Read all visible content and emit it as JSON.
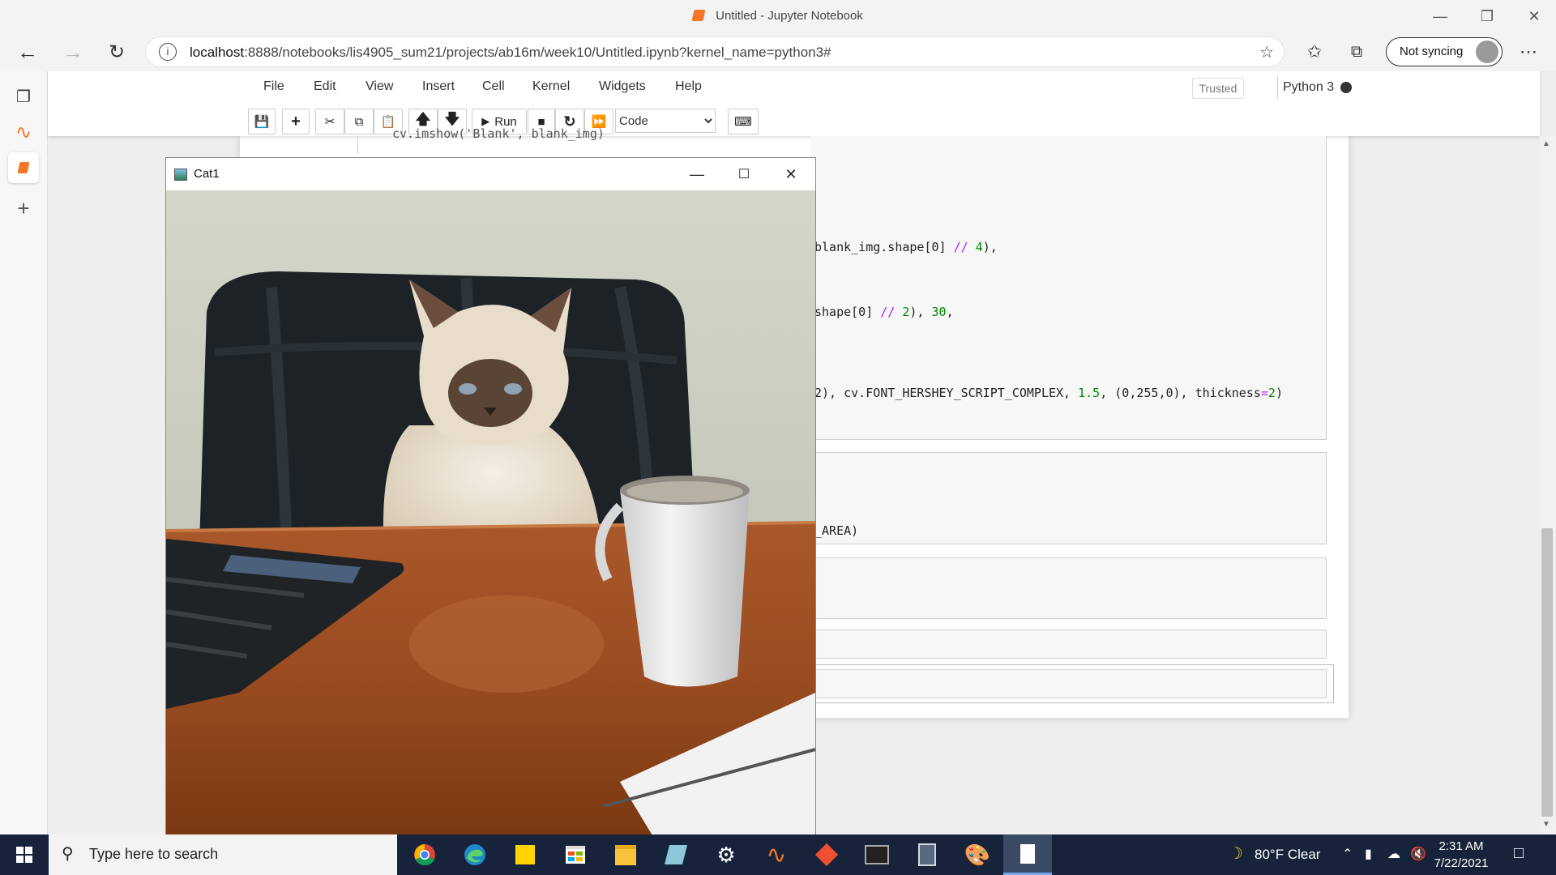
{
  "browser": {
    "window_title": "Untitled - Jupyter Notebook",
    "url_host": "localhost",
    "url_rest": ":8888/notebooks/lis4905_sum21/projects/ab16m/week10/Untitled.ipynb?kernel_name=python3#",
    "sync_label": "Not syncing"
  },
  "jupyter": {
    "menu": [
      "File",
      "Edit",
      "View",
      "Insert",
      "Cell",
      "Kernel",
      "Widgets",
      "Help"
    ],
    "trusted": "Trusted",
    "kernel": "Python 3",
    "run_label": "Run",
    "cell_type": "Code",
    "cell_type_options": [
      "Code"
    ]
  },
  "code": {
    "line_top": "cv.imshow('Blank', blank_img)",
    "line1_a": "blank_img.shape[0] ",
    "line1_op": "//",
    "line1_b": " ",
    "line1_n": "4",
    "line1_c": "),",
    "line2_a": "shape[0] ",
    "line2_op": "//",
    "line2_b": " ",
    "line2_n": "2",
    "line2_c": "), ",
    "line2_n2": "30",
    "line2_d": ",",
    "line3_a": "2), cv.FONT_HERSHEY_SCRIPT_COMPLEX, ",
    "line3_n": "1.5",
    "line3_b": ", (0,255,0), thickness",
    "line3_eq": "=",
    "line3_n2": "2",
    "line3_c": ")",
    "line4": "_AREA)"
  },
  "cv_window": {
    "title": "Cat1"
  },
  "taskbar": {
    "search_placeholder": "Type here to search",
    "weather": "80°F  Clear",
    "time": "2:31 AM",
    "date": "7/22/2021"
  }
}
